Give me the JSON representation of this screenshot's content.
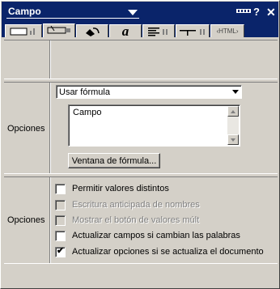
{
  "titlebar": {
    "title": "Campo",
    "icons": [
      "menu-dots-icon",
      "help-icon",
      "close-icon"
    ],
    "help_glyph": "?",
    "close_glyph": "✕"
  },
  "tabs": [
    {
      "name": "size-position-tab",
      "icon": "box-ruler-icon"
    },
    {
      "name": "field-tab",
      "icon": "field-pencil-icon",
      "active": true
    },
    {
      "name": "color-line-tab",
      "icon": "paint-bucket-icon"
    },
    {
      "name": "text-tab",
      "icon": "text-a-icon",
      "glyph": "a"
    },
    {
      "name": "paragraph-tab",
      "icon": "paragraph-lines-icon"
    },
    {
      "name": "tabs-tab",
      "icon": "tab-stop-icon"
    },
    {
      "name": "html-tab",
      "icon": "html-icon",
      "label": "‹HTML›"
    }
  ],
  "formula_section": {
    "label": "Opciones",
    "dropdown_value": "Usar fórmula",
    "formula_text": "Campo",
    "formula_button": "Ventana de fórmula..."
  },
  "options_section": {
    "label": "Opciones",
    "checkboxes": [
      {
        "label": "Permitir valores distintos",
        "checked": false,
        "enabled": true
      },
      {
        "label": "Escritura anticipada de nombres",
        "checked": false,
        "enabled": false
      },
      {
        "label": "Mostrar el botón de valores múlt",
        "checked": false,
        "enabled": false
      },
      {
        "label": "Actualizar campos si cambian las palabras",
        "checked": false,
        "enabled": true
      },
      {
        "label": "Actualizar opciones si se actualiza el documento",
        "checked": true,
        "enabled": true
      }
    ]
  },
  "colors": {
    "titlebar_bg": "#0a246a",
    "face": "#d4d0c8",
    "shadow": "#808080"
  }
}
